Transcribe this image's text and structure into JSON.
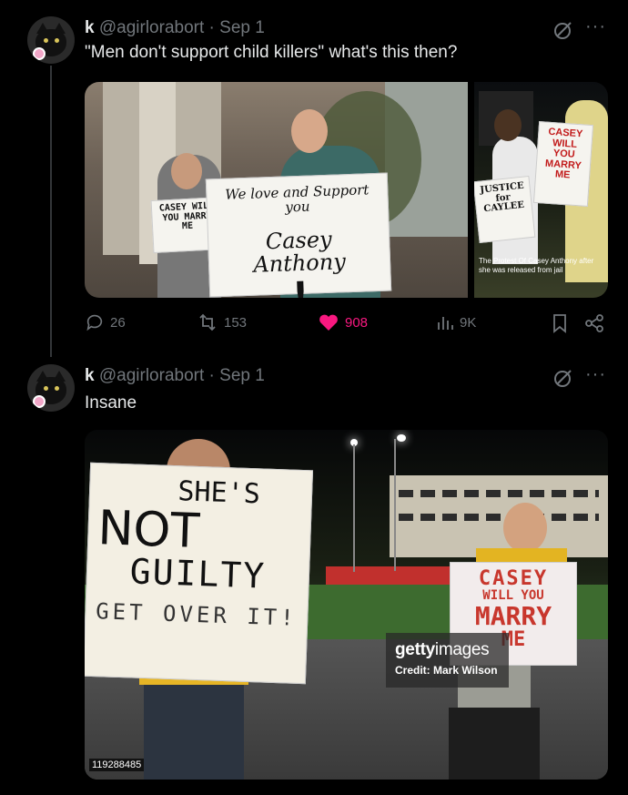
{
  "tweets": [
    {
      "name": "k",
      "handle": "@agirlorabort",
      "separator": "·",
      "date": "Sep 1",
      "text": "\"Men don't support child killers\" what's this then?",
      "media": {
        "left_sign_text": "CASEY WILL YOU MARRY ME",
        "center_sign_line1": "We love and Support you",
        "center_sign_line2": "Casey Anthony",
        "center_sign_mark": "!",
        "right_sign1": "JUSTICE for CAYLEE",
        "right_sign2": "CASEY WILL YOU MARRY ME",
        "right_caption": "The Protest Of Casey Anthony after she was released from jail"
      },
      "actions": {
        "replies": "26",
        "reposts": "153",
        "likes": "908",
        "views": "9K"
      }
    },
    {
      "name": "k",
      "handle": "@agirlorabort",
      "separator": "·",
      "date": "Sep 1",
      "text": "Insane",
      "media": {
        "sign1_line1": "SHE'S",
        "sign1_line2": "NOT",
        "sign1_line3": "GUILTY",
        "sign1_line4": "GET OVER IT!",
        "sign2_line1": "CASEY",
        "sign2_line2": "WILL YOU",
        "sign2_line3": "MARRY",
        "sign2_line4": "ME",
        "watermark_brand_bold": "getty",
        "watermark_brand_light": "images",
        "watermark_credit": "Credit: Mark Wilson",
        "photo_id": "119288485"
      }
    }
  ],
  "colors": {
    "background": "#000000",
    "text_primary": "#e7e9ea",
    "text_secondary": "#71767b",
    "like_pink": "#f91880"
  },
  "icons": [
    "reply-icon",
    "repost-icon",
    "heart-icon",
    "views-icon",
    "bookmark-icon",
    "share-icon",
    "grok-icon",
    "more-icon"
  ]
}
